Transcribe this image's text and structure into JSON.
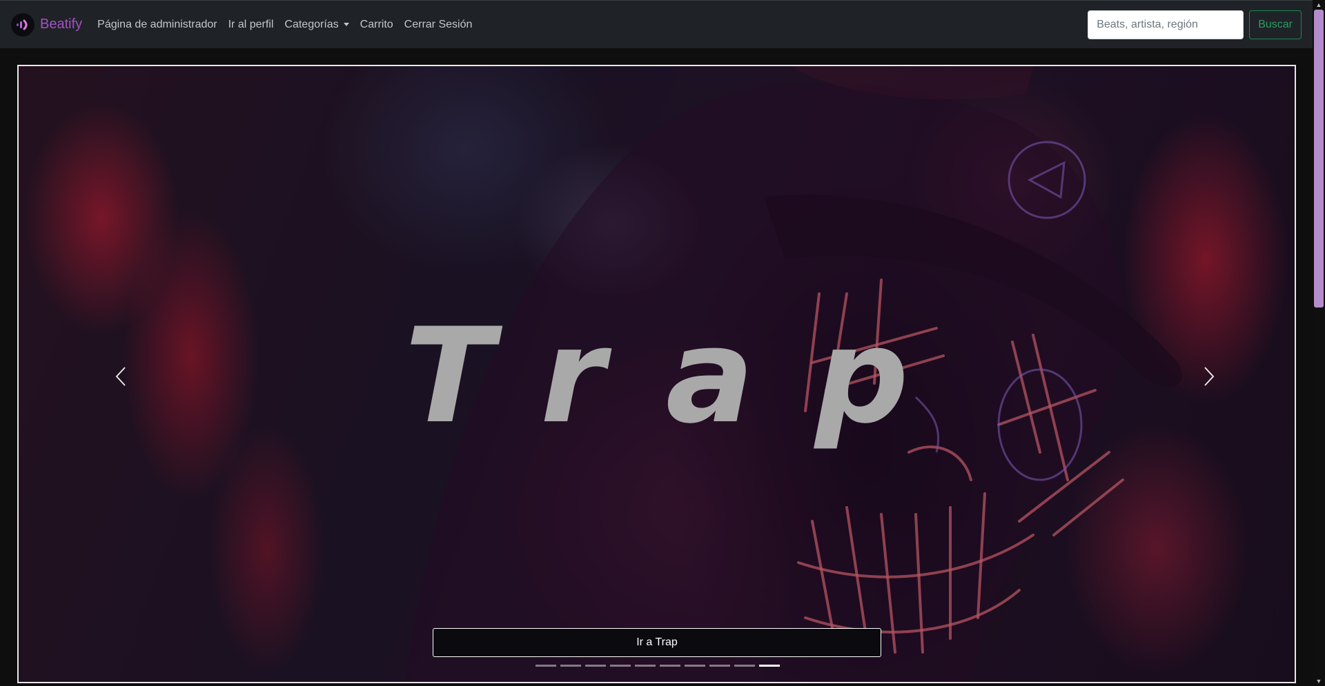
{
  "navbar": {
    "brand": "Beatify",
    "links": [
      "Página de administrador",
      "Ir al perfil",
      "Categorías",
      "Carrito",
      "Cerrar Sesión"
    ],
    "search": {
      "placeholder": "Beats, artista, región",
      "button_label": "Buscar"
    }
  },
  "carousel": {
    "slide_title": "Trap",
    "button_label": "Ir a Trap",
    "indicator_count": 10,
    "active_indicator": 10
  },
  "colors": {
    "brand": "#a64fc7",
    "navbar_bg": "#1f2327",
    "search_button": "#198754"
  },
  "icons": [
    "brand-logo-icon",
    "caret-down-icon",
    "chevron-left-icon",
    "chevron-right-icon"
  ]
}
